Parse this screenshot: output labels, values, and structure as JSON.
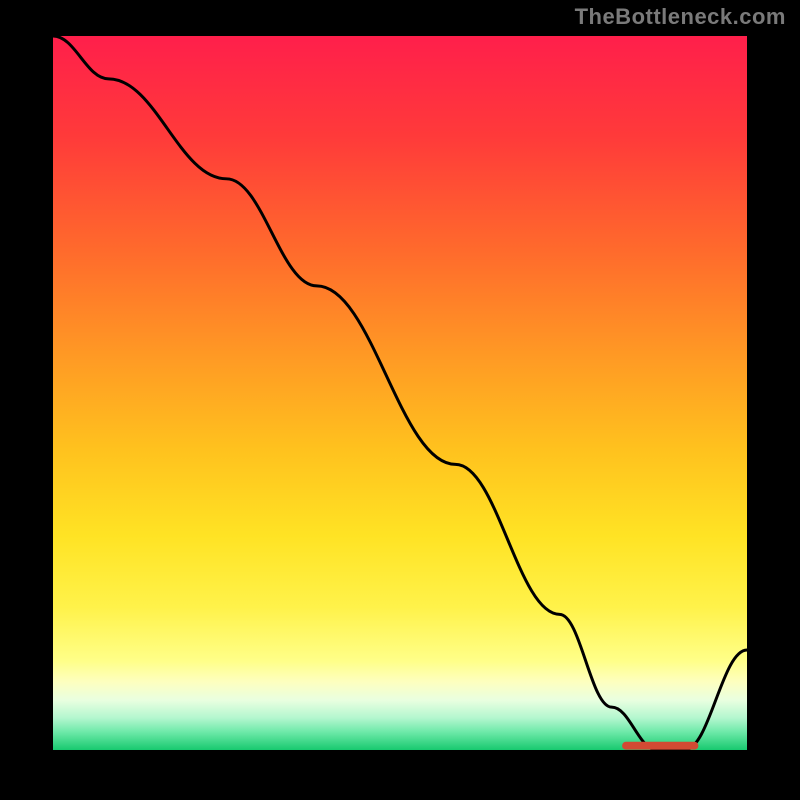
{
  "attribution": "TheBottleneck.com",
  "chart_data": {
    "type": "line",
    "title": "",
    "xlabel": "",
    "ylabel": "",
    "xlim": [
      0,
      100
    ],
    "ylim": [
      0,
      100
    ],
    "series": [
      {
        "name": "curve",
        "x": [
          0,
          8,
          25,
          38,
          58,
          73,
          80.5,
          87,
          91,
          100
        ],
        "y": [
          100,
          94,
          80,
          65,
          40,
          19,
          6,
          0,
          0,
          14
        ]
      }
    ],
    "optimal_marker": {
      "x_start": 82,
      "x_end": 93,
      "y": 0.6,
      "color": "#d24a33"
    },
    "background_gradient": {
      "stops": [
        {
          "offset": 0.0,
          "color": "#ff1f4b"
        },
        {
          "offset": 0.14,
          "color": "#ff3a3a"
        },
        {
          "offset": 0.3,
          "color": "#ff6a2c"
        },
        {
          "offset": 0.45,
          "color": "#ff9a24"
        },
        {
          "offset": 0.58,
          "color": "#ffc21e"
        },
        {
          "offset": 0.7,
          "color": "#ffe324"
        },
        {
          "offset": 0.8,
          "color": "#fff24a"
        },
        {
          "offset": 0.875,
          "color": "#ffff88"
        },
        {
          "offset": 0.905,
          "color": "#fdffc0"
        },
        {
          "offset": 0.93,
          "color": "#e9ffe0"
        },
        {
          "offset": 0.955,
          "color": "#b4f7cf"
        },
        {
          "offset": 0.975,
          "color": "#6de9a8"
        },
        {
          "offset": 1.0,
          "color": "#18c96f"
        }
      ]
    }
  }
}
